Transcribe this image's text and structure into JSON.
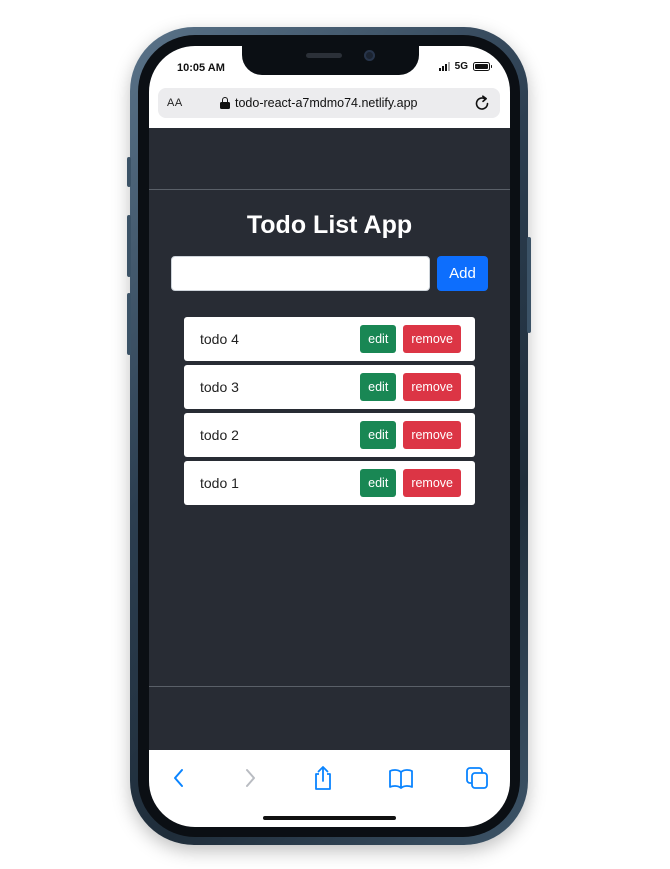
{
  "status_bar": {
    "time": "10:05 AM",
    "network": "5G"
  },
  "browser": {
    "text_size_label": "AA",
    "url": "todo-react-a7mdmo74.netlify.app"
  },
  "app": {
    "title": "Todo List App",
    "input_value": "",
    "add_label": "Add",
    "todos": [
      {
        "text": "todo 4",
        "edit_label": "edit",
        "remove_label": "remove"
      },
      {
        "text": "todo 3",
        "edit_label": "edit",
        "remove_label": "remove"
      },
      {
        "text": "todo 2",
        "edit_label": "edit",
        "remove_label": "remove"
      },
      {
        "text": "todo 1",
        "edit_label": "edit",
        "remove_label": "remove"
      }
    ]
  },
  "toolbar": {
    "icons": [
      "back-icon",
      "forward-icon",
      "share-icon",
      "bookmarks-icon",
      "tabs-icon"
    ]
  },
  "colors": {
    "page_bg": "#282c34",
    "primary": "#0d6efd",
    "success": "#198754",
    "danger": "#dc3545",
    "safari_blue": "#0a84ff"
  }
}
